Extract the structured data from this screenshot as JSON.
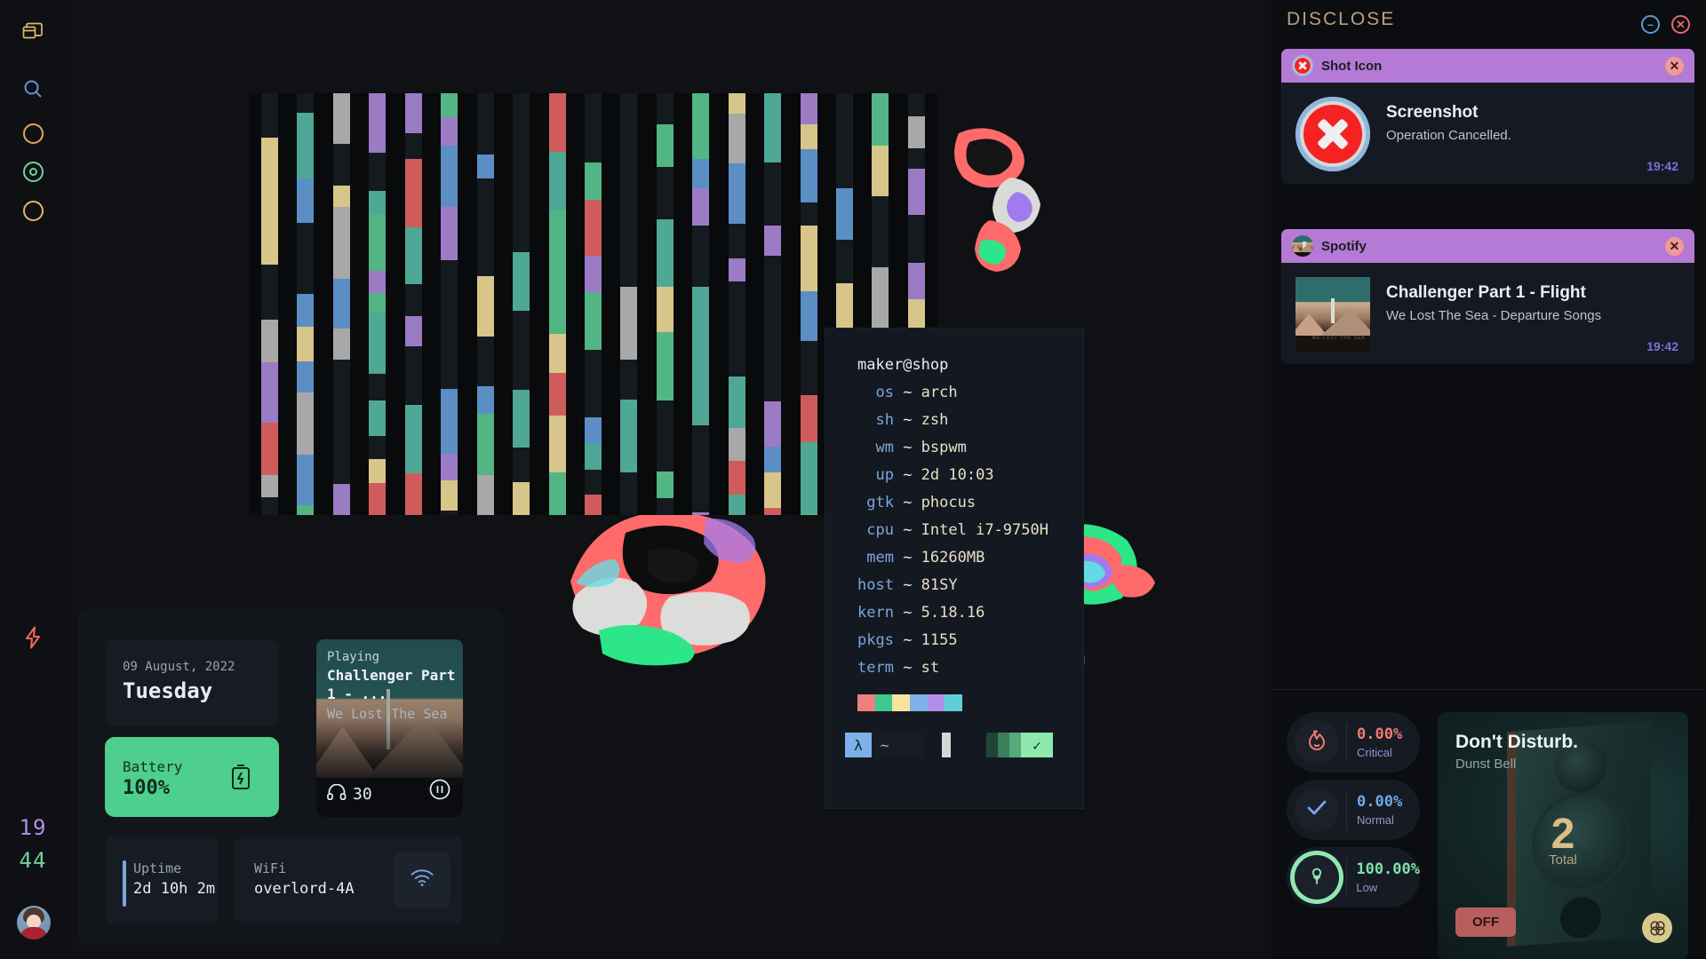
{
  "dock": {
    "items": [
      {
        "name": "windows-icon",
        "icon": "windows",
        "color": "#e0b86a"
      },
      {
        "name": "search-icon",
        "icon": "search",
        "color": "#6f8fd4"
      },
      {
        "name": "circle-icon-1",
        "icon": "circle",
        "color": "#e0a85a"
      },
      {
        "name": "target-icon",
        "icon": "target",
        "color": "#6fd49a"
      },
      {
        "name": "circle-icon-2",
        "icon": "circle",
        "color": "#e0b86a"
      }
    ],
    "power_icon": "bolt-icon",
    "clock_hour": "19",
    "clock_minute": "44"
  },
  "terminal": {
    "user_host": "maker@shop",
    "tilde": "~",
    "rows": [
      {
        "key": "os",
        "value": "arch"
      },
      {
        "key": "sh",
        "value": "zsh"
      },
      {
        "key": "wm",
        "value": "bspwm"
      },
      {
        "key": "up",
        "value": "2d 10:03"
      },
      {
        "key": "gtk",
        "value": "phocus"
      },
      {
        "key": "cpu",
        "value": "Intel i7-9750H"
      },
      {
        "key": "mem",
        "value": "16260MB"
      },
      {
        "key": "host",
        "value": "81SY"
      },
      {
        "key": "kern",
        "value": "5.18.16"
      },
      {
        "key": "pkgs",
        "value": "1155"
      },
      {
        "key": "term",
        "value": "st"
      }
    ],
    "palette": [
      "#f08080",
      "#3ec98f",
      "#f7e3a0",
      "#7db1e8",
      "#b48ee8",
      "#5ecfd8"
    ],
    "status": {
      "lambda": "λ",
      "tilde": "~",
      "check": "✓"
    }
  },
  "widgets": {
    "date": "09 August, 2022",
    "weekday": "Tuesday",
    "battery_label": "Battery",
    "battery_value": "100%",
    "battery_icon": "battery-charging-icon",
    "player": {
      "status": "Playing",
      "title": "Challenger Part 1 - ...",
      "artist": "We Lost The Sea",
      "volume_icon": "headphones-icon",
      "volume": "30",
      "transport_icon": "pause-icon",
      "art_caption": "WE LOST THE SEA DEPARTURE SONGS"
    },
    "uptime_label": "Uptime",
    "uptime_value": "2d 10h 2m",
    "wifi_label": "WiFi",
    "wifi_value": "overlord-4A",
    "wifi_icon": "wifi-icon"
  },
  "panel": {
    "title": "DISCLOSE",
    "minimize_icon": "minimize-circle-icon",
    "close_icon": "close-circle-icon",
    "notifications": [
      {
        "app": "Shot Icon",
        "app_icon": "error-x-icon",
        "close_icon": "close-icon",
        "thumb": "error-x-icon",
        "title": "Screenshot",
        "body": "Operation Cancelled.",
        "time": "19:42"
      },
      {
        "app": "Spotify",
        "app_icon": "album-art-icon",
        "close_icon": "close-icon",
        "thumb": "album-art",
        "title": "Challenger Part 1 - Flight",
        "body": "We Lost The Sea - Departure Songs",
        "time": "19:42"
      }
    ],
    "stats": [
      {
        "icon": "flame-icon",
        "pct": "0.00%",
        "label": "Critical",
        "color": "#f07a74",
        "ring": false
      },
      {
        "icon": "check-icon",
        "pct": "0.00%",
        "label": "Normal",
        "color": "#6fa8e8",
        "ring": false
      },
      {
        "icon": "tree-icon",
        "pct": "100.00%",
        "label": "Low",
        "color": "#7fe0a8",
        "ring": true
      }
    ],
    "dnd": {
      "title": "Don't Disturb.",
      "subtitle": "Dunst Bell",
      "count": "2",
      "count_label": "Total",
      "toggle_label": "OFF",
      "knob_icon": "dnd-knob-icon"
    }
  },
  "colors": {
    "accent_purple": "#b47ad6",
    "accent_green": "#4ecf8d",
    "accent_gold": "#b9a07c",
    "bg": "#0f1115",
    "panel_bg": "#0b0d11",
    "card_bg": "#161b23"
  },
  "wallpaper": {
    "bar_palette": [
      "#5b8ec4",
      "#a8a8a8",
      "#4fa795",
      "#d8c58a",
      "#9b7bc4",
      "#cf5c5c",
      "#52b583",
      "#151a1f"
    ],
    "bar_columns": 19
  }
}
